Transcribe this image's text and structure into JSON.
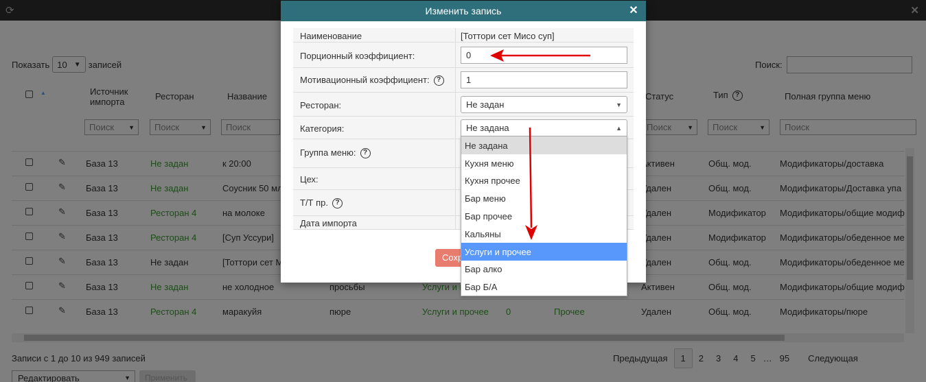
{
  "page": {
    "show_label": "Показать",
    "show_value": "10",
    "records_label": "записей",
    "search_label": "Поиск:",
    "columns": [
      "Источник импорта",
      "Ресторан",
      "Название",
      "Статус",
      "Тип",
      "Полная группа меню"
    ],
    "filter_placeholder": "Поиск",
    "rows": [
      {
        "src": "База 13",
        "rest": "Не задан",
        "name": "к 20:00",
        "status": "Активен",
        "type": "Общ. мод.",
        "group": "Модификаторы/доставка"
      },
      {
        "src": "База 13",
        "rest": "Не задан",
        "name": "Соусник 50 мл",
        "status": "Удален",
        "type": "Общ. мод.",
        "group": "Модификаторы/Доставка упа"
      },
      {
        "src": "База 13",
        "rest": "Ресторан 4",
        "name": "на молоке",
        "status": "Удален",
        "type": "Модификатор",
        "group": "Модификаторы/общие модиф"
      },
      {
        "src": "База 13",
        "rest": "Ресторан 4",
        "name": "[Суп Уссури]",
        "status": "Удален",
        "type": "Модификатор",
        "group": "Модификаторы/обеденное ме"
      },
      {
        "src": "База 13",
        "rest": "Не задан",
        "name": "[Тоттори сет М",
        "status": "Удален",
        "type": "Общ. мод.",
        "group": "Модификаторы/обеденное ме"
      },
      {
        "src": "База 13",
        "rest": "Не задан",
        "name": "не холодное",
        "extra1": "просьбы",
        "extra2": "Услуги и п",
        "status": "Активен",
        "type": "Общ. мод.",
        "group": "Модификаторы/общие модиф"
      },
      {
        "src": "База 13",
        "rest": "Ресторан 4",
        "name": "маракуйя",
        "extra1": "пюре",
        "extra2": "Услуги и прочее",
        "extra3": "0",
        "extra4": "Прочее",
        "status": "Удален",
        "type": "Общ. мод.",
        "group": "Модификаторы/пюре"
      }
    ],
    "footer_info": "Записи с 1 до 10 из 949 записей",
    "pager": {
      "prev": "Предыдущая",
      "pages": [
        "1",
        "2",
        "3",
        "4",
        "5",
        "…",
        "95"
      ],
      "next": "Следующая"
    },
    "bulk_action": "Редактировать",
    "apply_label": "Применить"
  },
  "modal": {
    "title": "Изменить запись",
    "fields": {
      "name_label": "Наименование",
      "name_value": "[Тоттори сет Мисо суп]",
      "portion_label": "Порционный коэффициент:",
      "portion_value": "0",
      "motivation_label": "Мотивационный коэффициент:",
      "motivation_value": "1",
      "restaurant_label": "Ресторан:",
      "restaurant_value": "Не задан",
      "category_label": "Категория:",
      "category_value": "Не задана",
      "menu_group_label": "Группа меню:",
      "workshop_label": "Цех:",
      "tt_label": "Т/Т пр.",
      "import_date_label": "Дата импорта"
    },
    "save_label": "Сохр",
    "category_options": [
      "Не задана",
      "Кухня меню",
      "Кухня прочее",
      "Бар меню",
      "Бар прочее",
      "Кальяны",
      "Услуги и прочее",
      "Бар алко",
      "Бар Б/А"
    ],
    "highlighted_option": "Услуги и прочее"
  },
  "colors": {
    "header": "#2f6f7c",
    "highlight": "#5897fb",
    "green_text": "#3a9b2e",
    "arrow": "#e00000"
  }
}
